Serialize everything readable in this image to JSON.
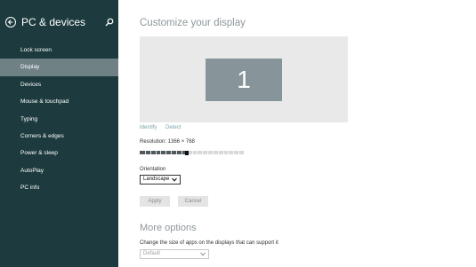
{
  "sidebar": {
    "title": "PC & devices",
    "items": [
      {
        "label": "Lock screen",
        "selected": false
      },
      {
        "label": "Display",
        "selected": true
      },
      {
        "label": "Devices",
        "selected": false
      },
      {
        "label": "Mouse & touchpad",
        "selected": false
      },
      {
        "label": "Typing",
        "selected": false
      },
      {
        "label": "Corners & edges",
        "selected": false
      },
      {
        "label": "Power & sleep",
        "selected": false
      },
      {
        "label": "AutoPlay",
        "selected": false
      },
      {
        "label": "PC info",
        "selected": false
      }
    ]
  },
  "main": {
    "heading": "Customize your display",
    "monitor_number": "1",
    "identify_label": "Identify",
    "detect_label": "Detect",
    "resolution_text": "Resolution: 1366 × 768",
    "resolution_slider_fraction": 0.45,
    "orientation_label": "Orientation",
    "orientation_value": "Landscape",
    "apply_label": "Apply",
    "cancel_label": "Cancel",
    "more_options_heading": "More options",
    "app_size_label": "Change the size of apps on the displays that can support it",
    "app_size_value": "Default"
  },
  "colors": {
    "sidebar_bg": "#1d3b3e",
    "sidebar_selected": "#6f8184",
    "monitor_tile": "#87959a",
    "link": "#7ea2ab"
  }
}
